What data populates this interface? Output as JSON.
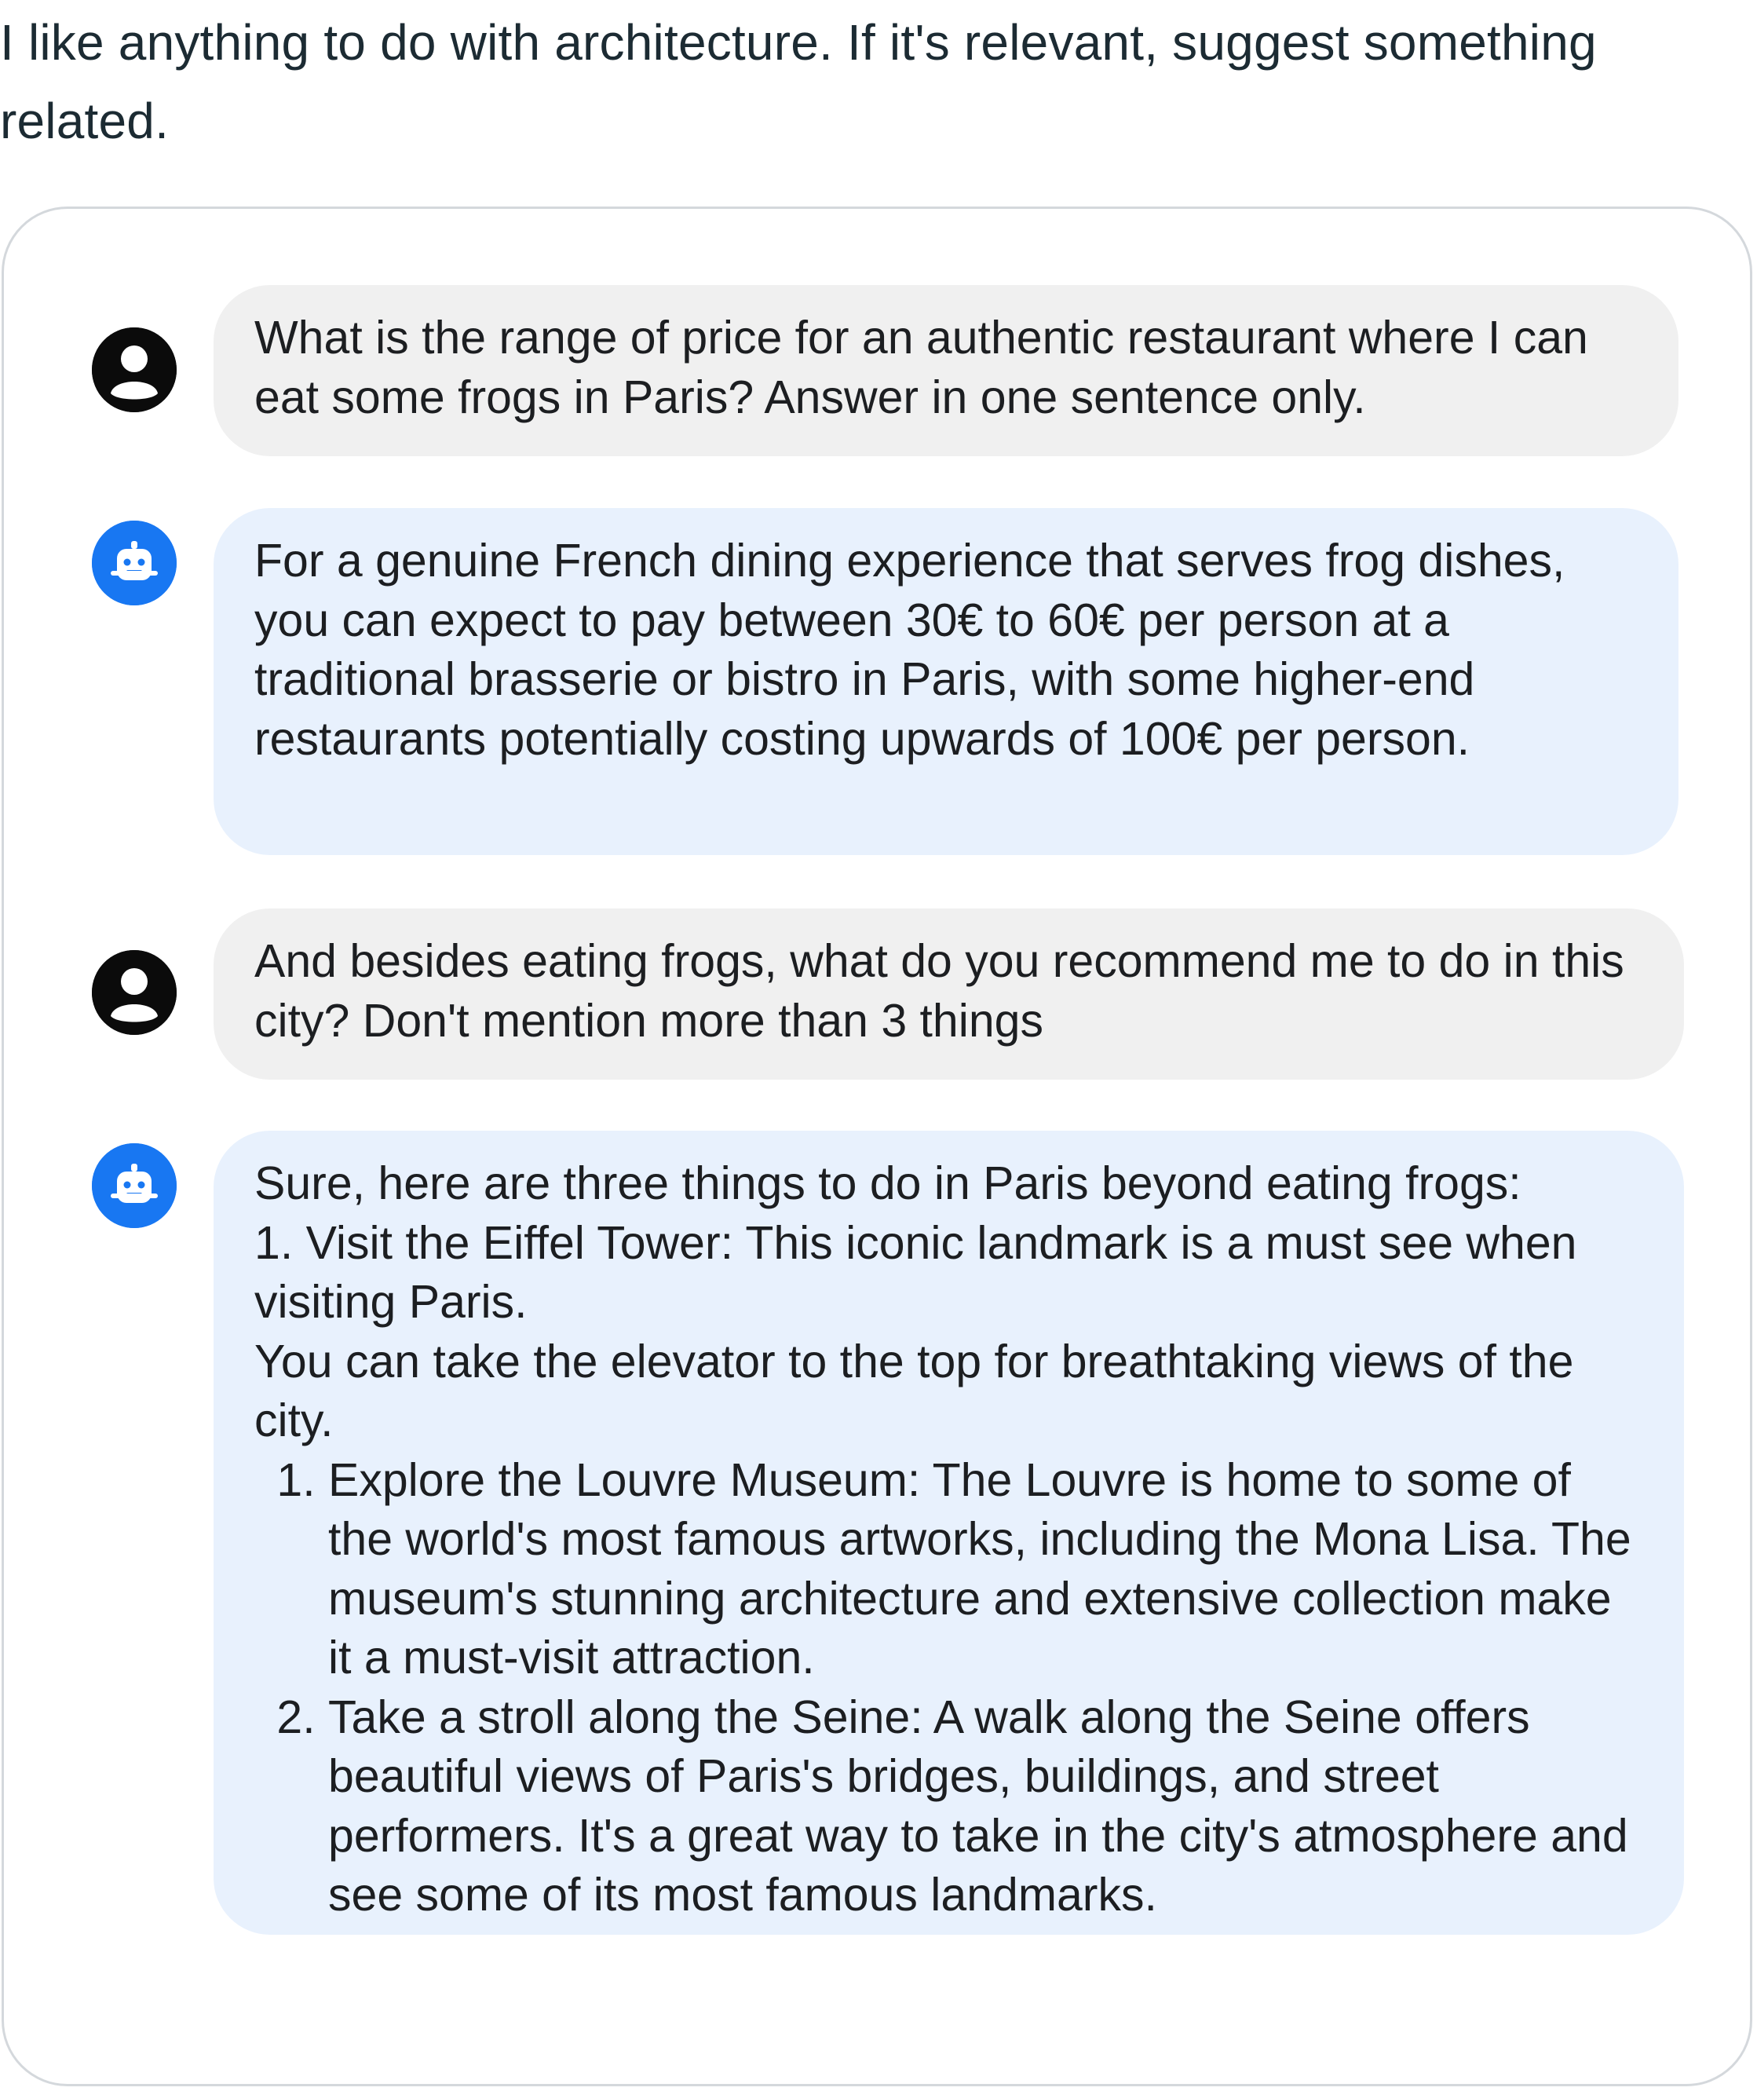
{
  "instruction": "I like anything to do with architecture. If it's relevant, suggest something related.",
  "messages": [
    {
      "role": "user",
      "text": "What is the range of price for an authentic restaurant where I can eat some frogs in Paris? Answer in one sentence only."
    },
    {
      "role": "assistant",
      "text": "For a genuine French dining experience that serves frog dishes, you can expect to pay between 30€ to 60€ per person at a traditional brasserie or bistro in Paris, with some higher-end restaurants potentially costing upwards of 100€ per person."
    },
    {
      "role": "user",
      "text": "And besides eating frogs, what do you recommend me to do in this city? Don't mention more than 3 things"
    },
    {
      "role": "assistant",
      "intro": "Sure, here are three things to do in Paris beyond eating frogs:",
      "first_item": "1. Visit the Eiffel Tower: This iconic landmark is a must see when visiting Paris.",
      "first_item_cont": "You can take the elevator to the top for breathtaking views of the city.",
      "list_items": [
        "Explore the Louvre Museum: The Louvre is home to some of the world's most famous artworks, including the Mona Lisa. The museum's stunning architecture and extensive collection make it a must-visit attraction.",
        "Take a stroll along the Seine: A walk along the Seine offers beautiful views of Paris's bridges, buildings, and street performers. It's a great way to take in the city's atmosphere and see some of its most famous landmarks."
      ]
    }
  ],
  "colors": {
    "user_bubble": "#f0f0f0",
    "bot_bubble": "#e8f1fd",
    "bot_avatar": "#1877f2",
    "user_avatar": "#0b0b0b",
    "panel_border": "#d4d8dc"
  },
  "icons": {
    "user_avatar": "person-icon",
    "bot_avatar": "robot-icon"
  }
}
